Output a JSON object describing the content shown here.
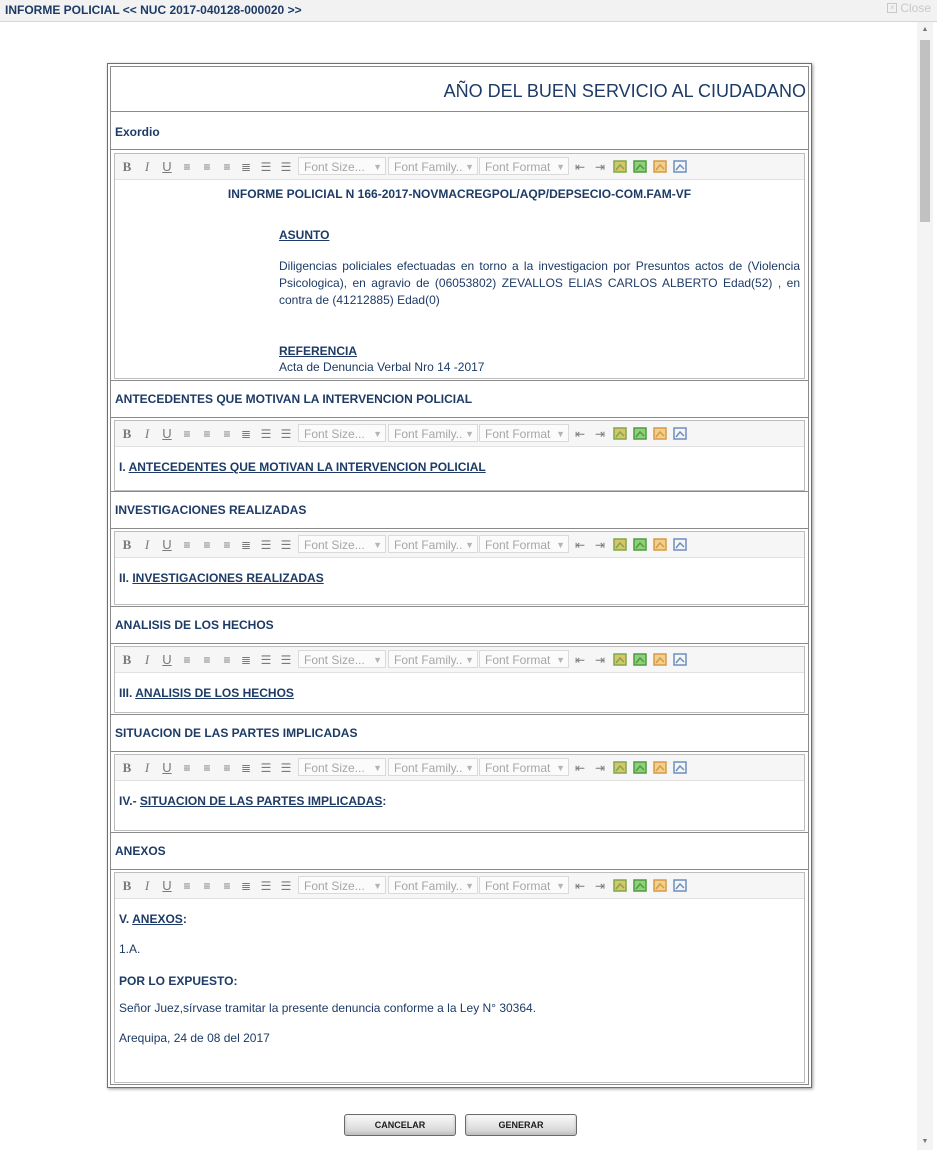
{
  "window": {
    "title": "INFORME POLICIAL << NUC 2017-040128-000020 >>",
    "close_label": "Close"
  },
  "doc": {
    "year_title": "AÑO DEL BUEN SERVICIO AL CIUDADANO"
  },
  "toolbar": {
    "bold": "B",
    "italic": "I",
    "underline": "U",
    "font_size": "Font Size...",
    "font_family": "Font Family..",
    "font_format": "Font Format",
    "icons": [
      "bold-icon",
      "italic-icon",
      "underline-icon",
      "align-left-icon",
      "align-center-icon",
      "align-right-icon",
      "justify-icon",
      "ordered-list-icon",
      "bullet-list-icon",
      "outdent-icon",
      "indent-icon",
      "insert-image-icon",
      "table-icon",
      "link-icon",
      "edit-html-icon"
    ]
  },
  "sections": {
    "exordio": {
      "label": "Exordio",
      "informe": "INFORME POLICIAL N 166-2017-NOVMACREGPOL/AQP/DEPSECIO-COM.FAM-VF",
      "asunto_h": "ASUNTO",
      "asunto_p": "Diligencias policiales efectuadas en torno a la investigacion por Presuntos actos de (Violencia Psicologica), en agravio de (06053802) ZEVALLOS ELIAS CARLOS ALBERTO Edad(52) , en contra de (41212885) Edad(0)",
      "ref_h": "REFERENCIA",
      "ref_p": "Acta de Denuncia Verbal Nro 14 -2017"
    },
    "antecedentes": {
      "label": "ANTECEDENTES QUE MOTIVAN LA INTERVENCION POLICIAL",
      "prefix": "I. ",
      "heading": "ANTECEDENTES QUE MOTIVAN LA INTERVENCION POLICIAL"
    },
    "investigaciones": {
      "label": "INVESTIGACIONES REALIZADAS",
      "prefix": "II. ",
      "heading": "INVESTIGACIONES REALIZADAS"
    },
    "analisis": {
      "label": "ANALISIS DE LOS HECHOS",
      "prefix": "III. ",
      "heading": "ANALISIS DE LOS HECHOS"
    },
    "situacion": {
      "label": "SITUACION DE LAS PARTES IMPLICADAS",
      "prefix": "IV.- ",
      "heading": "SITUACION DE LAS PARTES IMPLICADAS",
      "suffix": ":"
    },
    "anexos": {
      "label": "ANEXOS",
      "prefix": "V. ",
      "heading": "ANEXOS",
      "suffix": ":",
      "item": "1.A.",
      "expuesto": "POR LO EXPUESTO:",
      "juez": "Señor Juez,sírvase tramitar la presente denuncia conforme a la Ley N° 30364.",
      "fecha": "Arequipa, 24 de 08 del 2017"
    }
  },
  "buttons": {
    "cancel": "CANCELAR",
    "generate": "GENERAR"
  }
}
